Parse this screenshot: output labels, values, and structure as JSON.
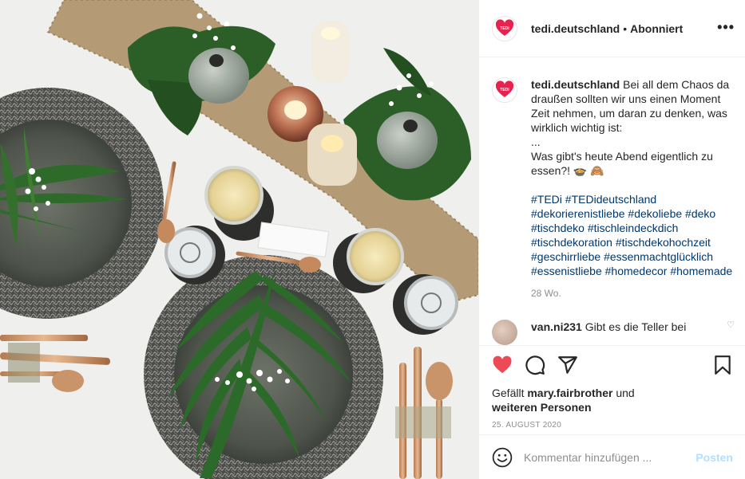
{
  "post": {
    "username": "tedi.deutschland",
    "separator": "•",
    "follow_status": "Abonniert",
    "more_label": "•••",
    "caption": {
      "username": "tedi.deutschland",
      "line1": " Bei all dem Chaos da draußen sollten wir uns einen Moment Zeit nehmen, um daran zu denken, was wirklich wichtig ist:",
      "line2": "...",
      "line3": "Was gibt's heute Abend eigentlich zu essen?! 🍲 🙈",
      "hashtags": [
        "#TEDi",
        "#TEDideutschland",
        "#dekorierenistliebe",
        "#dekoliebe",
        "#deko",
        "#tischdeko",
        "#tischleindeckdich",
        "#tischdekoration",
        "#tischdekohochzeit",
        "#geschirrliebe",
        "#essenmachtglücklich",
        "#essenistliebe",
        "#homedecor",
        "#homemade"
      ],
      "age": "28 Wo."
    },
    "comment": {
      "username": "van.ni231",
      "text": " Gibt es die Teller bei"
    },
    "likes": {
      "prefix": "Gefällt ",
      "user": "mary.fairbrother",
      "middle": " und",
      "rest": "weiteren Personen"
    },
    "date": "25. AUGUST 2020",
    "add_comment": {
      "placeholder": "Kommentar hinzufügen ...",
      "post_label": "Posten"
    }
  },
  "colors": {
    "brand_red": "#e8214f",
    "like_red": "#ed4956",
    "link_blue": "#00376b",
    "post_disabled": "#b2dffc",
    "muted": "#8e8e8e"
  },
  "icons": [
    "tedi-heart-logo",
    "heart-icon",
    "comment-icon",
    "share-icon",
    "bookmark-icon",
    "emoji-icon"
  ]
}
